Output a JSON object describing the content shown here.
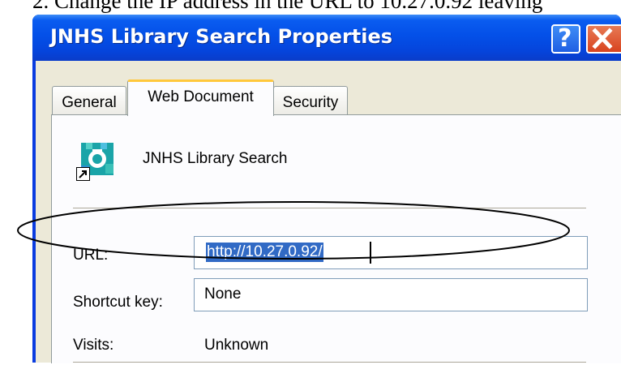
{
  "document": {
    "instruction_text": "2.  Change the IP address in the URL to 10.27.0.92 leaving"
  },
  "window": {
    "title": "JNHS Library Search Properties",
    "help_label": "?",
    "colors": {
      "titlebar": "#0450e8",
      "close": "#d8431f",
      "selection": "#316ac5",
      "face": "#ece9d8"
    }
  },
  "tabs": [
    {
      "label": "General",
      "active": false
    },
    {
      "label": "Web Document",
      "active": true
    },
    {
      "label": "Security",
      "active": false
    }
  ],
  "web_document": {
    "icon": "internet-shortcut-icon",
    "shortcut_name": "JNHS Library Search",
    "url": {
      "label": "URL:",
      "value": "http://10.27.0.92/",
      "selected": true
    },
    "shortcut_key": {
      "label": "Shortcut key:",
      "value": "None"
    },
    "visits": {
      "label": "Visits:",
      "value": "Unknown"
    }
  }
}
